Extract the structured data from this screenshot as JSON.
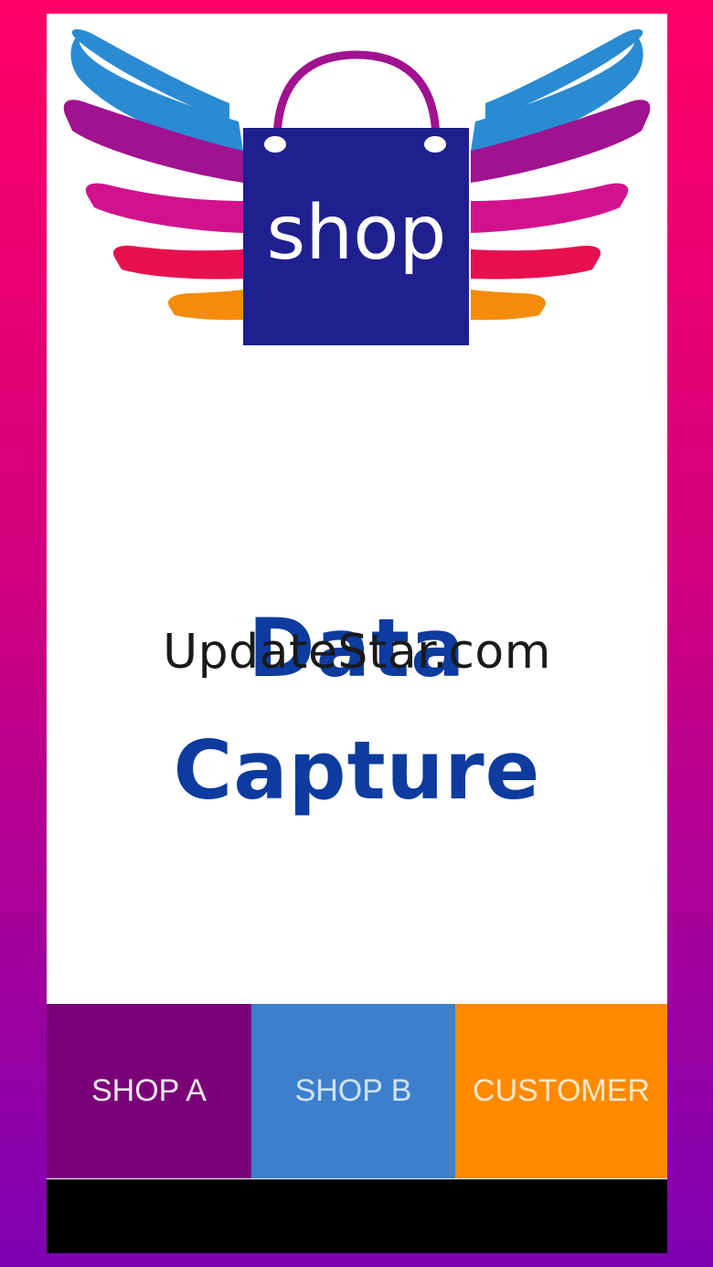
{
  "logo": {
    "text": "shop",
    "icon": "winged-shopping-bag-icon",
    "colors": {
      "bag": "#1F1F8F",
      "handle": "#A0128F",
      "wing_blue": "#2A8BD2",
      "wing_purple": "#A0128F",
      "wing_magenta": "#D2128D",
      "wing_red": "#E7104F",
      "wing_orange": "#F58B0B"
    }
  },
  "title": {
    "line1": "Data",
    "line2": "Capture",
    "color": "#0D3B9E"
  },
  "watermark": "UpdateStar.com",
  "tabs": [
    {
      "label": "SHOP A",
      "color": "#7A0077"
    },
    {
      "label": "SHOP B",
      "color": "#3D7FCA"
    },
    {
      "label": "CUSTOMER",
      "color": "#FF8A00"
    }
  ]
}
